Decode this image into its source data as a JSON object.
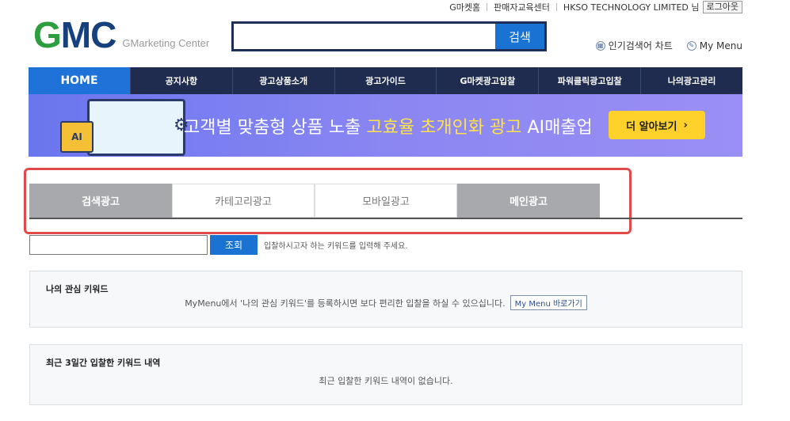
{
  "util_bar": {
    "link_gmarket_home": "G마켓홈",
    "link_seller_edu": "판매자교육센터",
    "user_label": "HKSO TECHNOLOGY LIMITED 님",
    "logout": "로그아웃"
  },
  "logo": {
    "g": "G",
    "mc": "MC",
    "subtitle": "GMarketing Center",
    "colors": {
      "g": "#2c9e3f",
      "mc": "#17417e"
    }
  },
  "search": {
    "value": "",
    "button": "검색"
  },
  "quick_links": {
    "popular_chart": "인기검색어 차트",
    "my_menu": "My Menu"
  },
  "gnb": {
    "items": [
      {
        "label": "HOME",
        "active": true
      },
      {
        "label": "공지사항"
      },
      {
        "label": "광고상품소개"
      },
      {
        "label": "광고가이드"
      },
      {
        "label": "G마켓광고입찰"
      },
      {
        "label": "파워클릭광고입찰"
      },
      {
        "label": "나의광고관리"
      }
    ],
    "colors": {
      "bar": "#1f2c50",
      "active": "#1f72d8"
    }
  },
  "banner": {
    "chip_label": "AI",
    "text_pre": "고객별 맞춤형 상품 노출 ",
    "text_highlight": "고효율 초개인화 광고",
    "text_post": " AI매출업",
    "cta": "더 알아보기",
    "cta_arrow": "›",
    "colors": {
      "bg": "#7a7ef0",
      "highlight": "#ffe24a",
      "cta": "#ffd12a"
    }
  },
  "tabs": [
    {
      "label": "검색광고",
      "style": "gray"
    },
    {
      "label": "카테고리광고",
      "style": "white"
    },
    {
      "label": "모바일광고",
      "style": "white"
    },
    {
      "label": "메인광고",
      "style": "gray"
    }
  ],
  "keyword_search": {
    "value": "",
    "button": "조회",
    "hint": "입찰하시고자 하는 키워드를 입력해 주세요."
  },
  "interest_keywords": {
    "title": "나의 관심 키워드",
    "message": "MyMenu에서 '나의 관심 키워드'를 등록하시면 보다 편리한 입찰을 하실 수 있으십니다.",
    "shortcut": "My Menu 바로가기"
  },
  "recent_bids": {
    "title": "최근 3일간 입찰한 키워드 내역",
    "message": "최근 입찰한 키워드 내역이 없습니다."
  }
}
